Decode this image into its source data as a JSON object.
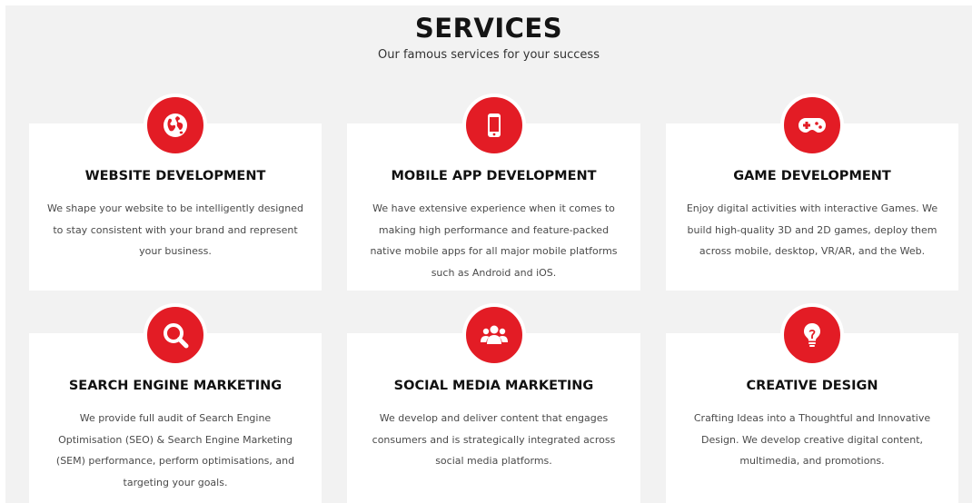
{
  "section": {
    "title": "SERVICES",
    "subtitle": "Our famous services for your success"
  },
  "colors": {
    "accent": "#e31c25",
    "section_background": "#f2f2f2",
    "card_background": "#ffffff",
    "title_text": "#111111",
    "body_text": "#4a4a4a"
  },
  "services": [
    {
      "icon": "globe-icon",
      "title": "WEBSITE DEVELOPMENT",
      "description": "We shape your website to be intelligently designed to stay consistent with your brand and represent your business."
    },
    {
      "icon": "mobile-phone-icon",
      "title": "MOBILE APP DEVELOPMENT",
      "description": "We have extensive experience when it comes to making high performance and feature-packed native mobile apps for all major mobile platforms such as Android and iOS."
    },
    {
      "icon": "gamepad-icon",
      "title": "GAME DEVELOPMENT",
      "description": "Enjoy digital activities with interactive Games. We build high-quality 3D and 2D games, deploy them across mobile, desktop, VR/AR, and the Web."
    },
    {
      "icon": "search-icon",
      "title": "SEARCH ENGINE MARKETING",
      "description": "We provide full audit of Search Engine Optimisation (SEO) & Search Engine Marketing (SEM) performance, perform optimisations, and targeting your goals."
    },
    {
      "icon": "users-icon",
      "title": "SOCIAL MEDIA MARKETING",
      "description": "We develop and deliver content that engages consumers and is strategically integrated across social media platforms."
    },
    {
      "icon": "lightbulb-icon",
      "title": "CREATIVE DESIGN",
      "description": "Crafting Ideas into a Thoughtful and Innovative Design. We develop creative digital content, multimedia, and promotions."
    }
  ]
}
